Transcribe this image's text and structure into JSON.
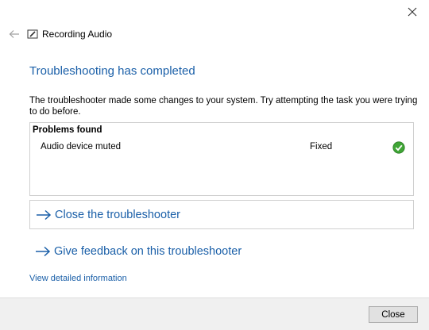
{
  "window": {
    "title": "Recording Audio",
    "close_icon": "close-icon",
    "back_icon": "back-arrow-icon",
    "app_icon": "troubleshooter-icon"
  },
  "main": {
    "heading": "Troubleshooting has completed",
    "description": "The troubleshooter made some changes to your system. Try attempting the task you were trying to do before.",
    "problems": {
      "header": "Problems found",
      "items": [
        {
          "name": "Audio device muted",
          "status": "Fixed",
          "status_icon": "green-check-icon"
        }
      ]
    },
    "actions": [
      {
        "label": "Close the troubleshooter",
        "icon": "arrow-right-icon"
      },
      {
        "label": "Give feedback on this troubleshooter",
        "icon": "arrow-right-icon"
      }
    ],
    "details_link": "View detailed information"
  },
  "footer": {
    "close_label": "Close"
  },
  "colors": {
    "accent": "#1a5fa8",
    "success": "#3fa535",
    "footer_bg": "#f0f0f0"
  }
}
